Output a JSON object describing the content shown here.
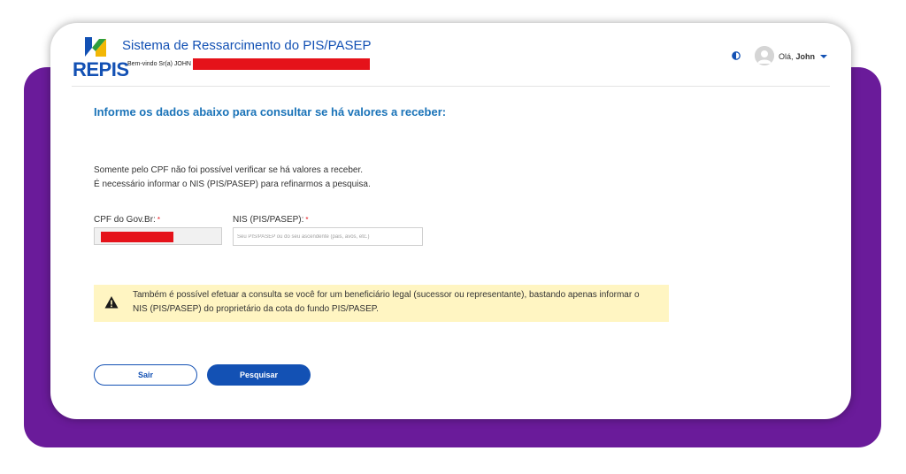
{
  "header": {
    "logo_text": "REPIS",
    "system_title": "Sistema de Ressarcimento do PIS/PASEP",
    "welcome_text": "Bem-vindo Sr(a) JOHN",
    "greeting": "Olá,",
    "user_name": "John",
    "icons": {
      "contrast": "contrast-icon",
      "avatar": "user-avatar",
      "dropdown": "chevron-down-icon"
    }
  },
  "main": {
    "title": "Informe os dados abaixo para consultar se há valores a receber:",
    "info_line_1": "Somente pelo CPF não foi possível verificar se há valores a receber.",
    "info_line_2": "É necessário informar o NIS (PIS/PASEP) para refinarmos a pesquisa."
  },
  "form": {
    "cpf_label": "CPF do Gov.Br:",
    "nis_label": "NIS (PIS/PASEP):",
    "required_mark": "*",
    "nis_placeholder": "Seu PIS/PASEP ou do seu ascendente (pais, avós, etc.)"
  },
  "alert": {
    "line_1": "Também é possível efetuar a consulta se você for um beneficiário legal (sucessor ou representante), bastando apenas informar o",
    "line_2": "NIS (PIS/PASEP) do proprietário da cota do fundo PIS/PASEP.",
    "icon": "warning-icon"
  },
  "buttons": {
    "exit_label": "Sair",
    "search_label": "Pesquisar"
  },
  "colors": {
    "primary": "#1351b4",
    "title_blue": "#1a73b8",
    "frame_purple": "#6a1b9a",
    "alert_bg": "#fff5c2",
    "redaction": "#e5121a"
  }
}
